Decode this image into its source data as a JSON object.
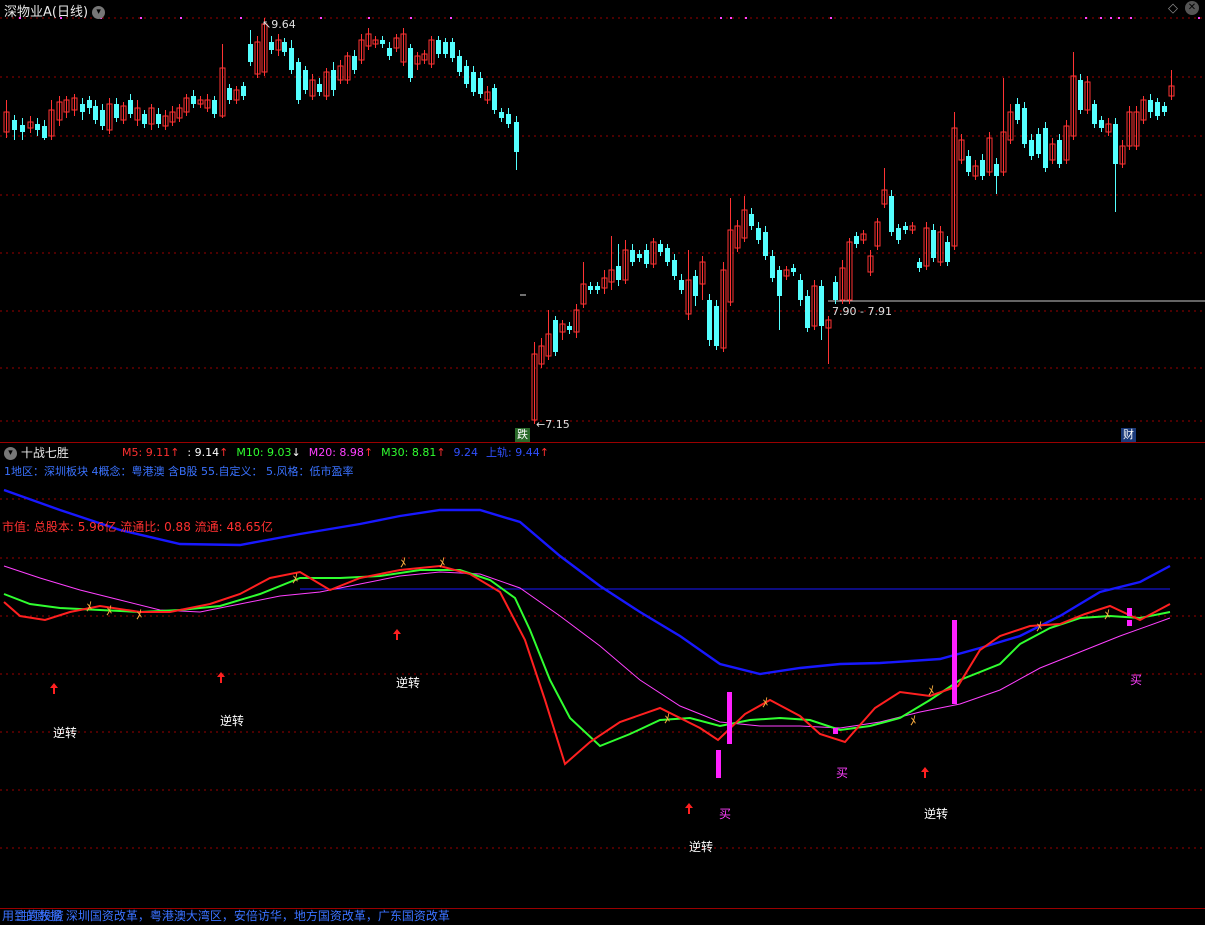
{
  "window": {
    "title": "深物业A(日线)",
    "nav_left_icon": "triangle-left-icon",
    "nav_right_icon": "triangle-right-icon",
    "close_icon": "close-icon"
  },
  "main_chart": {
    "high_label": "9.64",
    "low_label": "7.15",
    "price_line_label": "7.90 - 7.91",
    "badge_fall": "跌",
    "badge_finance": "财"
  },
  "indicator": {
    "name": "十战七胜",
    "legend": [
      {
        "text": "M5: 9.11",
        "arrow": "↑",
        "color": "#ff3030",
        "arrow_color": "#ff3030"
      },
      {
        "text": ": 9.14",
        "arrow": "↑",
        "color": "#ffffff",
        "arrow_color": "#ff3030"
      },
      {
        "text": "M10: 9.03",
        "arrow": "↓",
        "color": "#30ff30",
        "arrow_color": "#ffffff"
      },
      {
        "text": "M20: 8.98",
        "arrow": "↑",
        "color": "#ff40ff",
        "arrow_color": "#ff3030"
      },
      {
        "text": "M30: 8.81",
        "arrow": "↑",
        "color": "#30ff30",
        "arrow_color": "#ff3030"
      },
      {
        "text": "9.24",
        "arrow": "",
        "color": "#3050ff",
        "arrow_color": "#ff3030"
      },
      {
        "text": "上轨: 9.44",
        "arrow": "↑",
        "color": "#3050ff",
        "arrow_color": "#ff3030"
      }
    ],
    "info_line": "1地区：深圳板块   4概念：粤港澳 含B股   55.自定义：  5.风格：低市盈率",
    "market_value": "市值: 总股本: 5.96亿  流通比: 0.88  流通: 48.65亿",
    "labels": {
      "reversal": "逆转",
      "buy": "买"
    }
  },
  "bottom_bar": {
    "text": "用到的数据  深圳国资改革，粤港澳大湾区，安倍访华，地方国资改革，广东国资改革",
    "overlap_text": "主题投资"
  },
  "colors": {
    "up": "#ff3333",
    "down": "#54ffff",
    "m5": "#ff2020",
    "m10": "#30ff30",
    "m20": "#ff40ff",
    "upper_band": "#1818ff",
    "grid": "#9a0000",
    "buy": "#ff20ff",
    "arrow": "#ff2020"
  }
}
